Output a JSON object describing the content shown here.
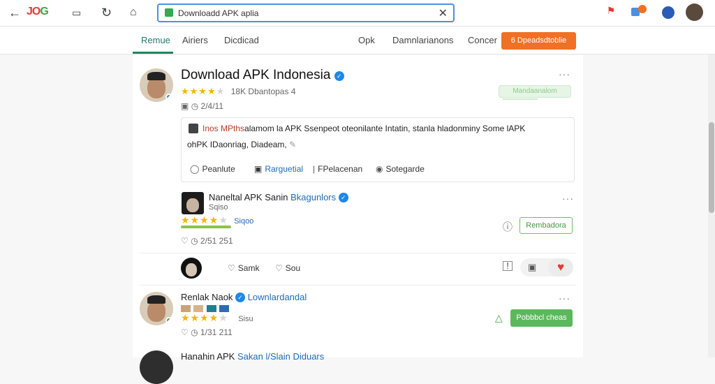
{
  "browser": {
    "url": "Downloadd APK aplia",
    "logo_a": "JO",
    "logo_b": "G"
  },
  "tabs": {
    "home": "Remue",
    "airtime": "Airiers",
    "download": "Dicdicad",
    "opk": "Opk",
    "downloads": "Damnlarianons",
    "concer": "Concer"
  },
  "cta_label": "6 Dpeadsdtoblie",
  "post": {
    "title": "Download APK Indonesia",
    "rating_text": "18K  Dbantopas  4",
    "meta": "2/4/11",
    "pill_label": "Mandaanalom",
    "body_highlight": "Inos MPths",
    "body_line1": "alamom la APK  Ssenpeot  oteonilante  Intatin,  stanla  hladonminy  Some  lAPK",
    "body_line2": "ohPK  IDaonriag,  Diadeam,",
    "actions": {
      "reply": "Peanlute",
      "share": "Rarguetial",
      "relation": "FPelacenan",
      "comment": "Sotegarde"
    }
  },
  "comment1": {
    "name": "Naneltal APK Sanin",
    "tag": "Bkagunlors",
    "sub": "Sqiso",
    "rating_label": "Siqoo",
    "meta": "2/51  251",
    "button": "Rembadora",
    "action_a": "Samk",
    "action_b": "Sou"
  },
  "comment2": {
    "name": "Renlak Naok",
    "tag": "Lownlardandal",
    "meta": "1/31  211",
    "rating_label": "Sisu",
    "button": "Pobbbcl cheas"
  },
  "comment3": {
    "name": "Hanahin APK",
    "tag": "Sakan  l/Slain  Diduars"
  },
  "colors": {
    "accent_orange": "#f07025",
    "green": "#5cb85c",
    "verified": "#1e88e5",
    "url_border": "#4a90e2"
  }
}
